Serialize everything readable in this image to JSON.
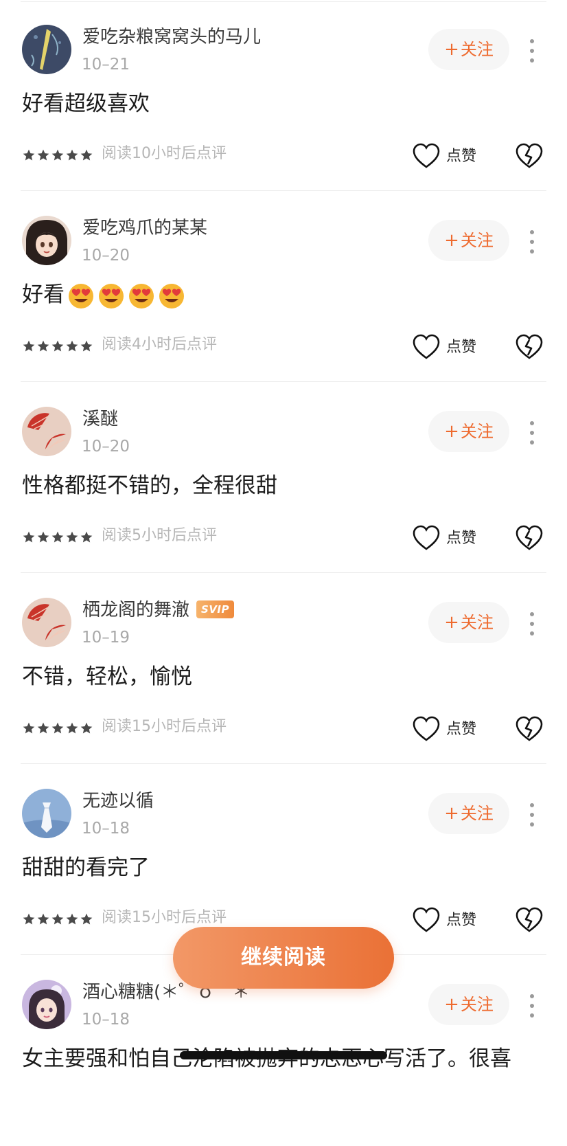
{
  "follow_label": "关注",
  "like_label": "点赞",
  "continue_reading_label": "继续阅读",
  "accent_color": "#ee6a2e",
  "comments": [
    {
      "username": "爱吃杂粮窝窝头的马儿",
      "date": "10–21",
      "content": "好看超级喜欢",
      "rating_note": "阅读10小时后点评",
      "stars": 5,
      "avatar_icon": "dark-blue-feather-avatar"
    },
    {
      "username": "爱吃鸡爪的某某",
      "date": "10–20",
      "content": "好看",
      "emoji_count": 4,
      "emoji_icon": "heart-eyes-emoji",
      "rating_note": "阅读4小时后点评",
      "stars": 5,
      "avatar_icon": "anime-girl-avatar"
    },
    {
      "username": "溪醚",
      "date": "10–20",
      "content": "性格都挺不错的，全程很甜",
      "rating_note": "阅读5小时后点评",
      "stars": 5,
      "avatar_icon": "red-fan-avatar"
    },
    {
      "username": "栖龙阁的舞澈",
      "badge": "SVIP",
      "date": "10–19",
      "content": "不错，轻松，愉悦",
      "rating_note": "阅读15小时后点评",
      "stars": 5,
      "avatar_icon": "red-fan-avatar"
    },
    {
      "username": "无迹以循",
      "date": "10–18",
      "content": "甜甜的看完了",
      "rating_note": "阅读15小时后点评",
      "stars": 5,
      "avatar_icon": "blue-tie-avatar"
    },
    {
      "username": "酒心糖糖(＊゜ｏ゜＊",
      "date": "10–18",
      "content": "女主要强和怕自己沦陷被抛弃的忐忑心写活了。很喜",
      "avatar_icon": "anime-girl-cat-avatar"
    }
  ]
}
